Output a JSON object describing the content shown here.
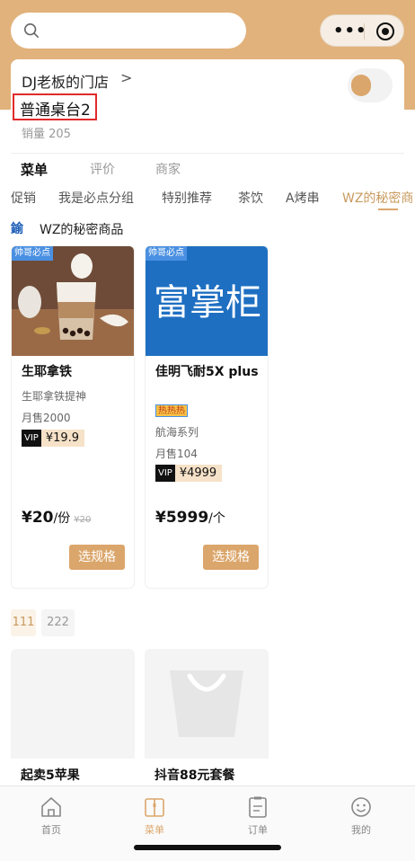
{
  "header": {
    "menu_dots": "•••"
  },
  "shop": {
    "name": "DJ老板的门店",
    "chevron": ">",
    "table_name": "普通桌台2",
    "sales": "销量 205"
  },
  "tabs": [
    {
      "label": "菜单",
      "active": true
    },
    {
      "label": "评价",
      "active": false
    },
    {
      "label": "商家",
      "active": false
    }
  ],
  "categories": [
    {
      "label": "促销",
      "active": false
    },
    {
      "label": "我是必点分组",
      "active": false
    },
    {
      "label": "特别推荐",
      "active": false
    },
    {
      "label": "茶饮",
      "active": false
    },
    {
      "label": "A烤串",
      "active": false
    },
    {
      "label": "WZ的秘密商",
      "active": true
    }
  ],
  "section": {
    "icon_text": "鍮",
    "title": "WZ的秘密商品"
  },
  "products": [
    {
      "tag": "帅哥必点",
      "name": "生耶拿铁",
      "subtitle": "生耶拿铁提神",
      "monthly_sales": "月售2000",
      "vip_label": "VIP",
      "vip_price": "¥19.9",
      "price": "¥20",
      "unit": "/份",
      "original_price": "¥20",
      "button": "选规格",
      "image": "iced-coconut-latte-photo"
    },
    {
      "tag": "帅哥必点",
      "name": "佳明飞耐5X plus",
      "badge": "热热热",
      "series": "航海系列",
      "monthly_sales": "月售104",
      "vip_label": "VIP",
      "vip_price": "¥4999",
      "price": "¥5999",
      "unit": "/个",
      "button": "选规格",
      "image_text": "富掌柜"
    }
  ],
  "sub_categories": [
    {
      "label": "111",
      "active": true
    },
    {
      "label": "222",
      "active": false
    }
  ],
  "placeholder_products": [
    {
      "name": "起卖5苹果"
    },
    {
      "name": "抖音88元套餐"
    }
  ],
  "tabbar": [
    {
      "label": "首页",
      "icon": "home-icon",
      "active": false
    },
    {
      "label": "菜单",
      "icon": "menu-book-icon",
      "active": true
    },
    {
      "label": "订单",
      "icon": "order-list-icon",
      "active": false
    },
    {
      "label": "我的",
      "icon": "smiley-icon",
      "active": false
    }
  ],
  "colors": {
    "accent": "#dba66b",
    "header_bg": "#e1b27c",
    "highlight_border": "#e12a2a",
    "tag_blue": "#4a90e2"
  }
}
